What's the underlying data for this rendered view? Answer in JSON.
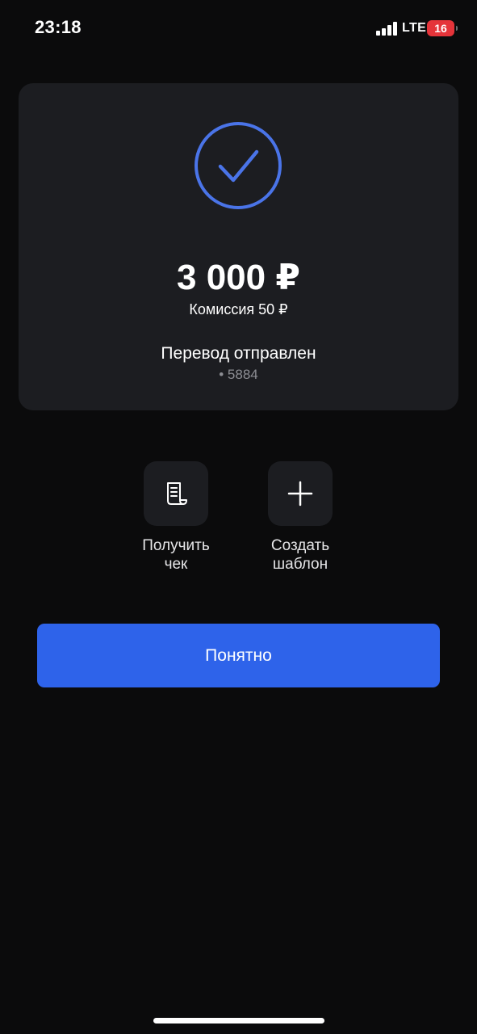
{
  "status_bar": {
    "time": "23:18",
    "network": "LTE",
    "battery": "16",
    "signal_icon": "cellular-signal-icon",
    "battery_color": "#e5343a"
  },
  "result": {
    "icon": "check-circle-icon",
    "accent_color": "#4a74e8",
    "amount": "3 000 ₽",
    "commission": "Комиссия 50 ₽",
    "status": "Перевод отправлен",
    "card_number": "• 5884"
  },
  "actions": [
    {
      "icon": "receipt-icon",
      "label": "Получить\nчек"
    },
    {
      "icon": "plus-icon",
      "label": "Создать\nшаблон"
    }
  ],
  "primary_button": {
    "label": "Понятно",
    "color": "#2e63ea"
  }
}
